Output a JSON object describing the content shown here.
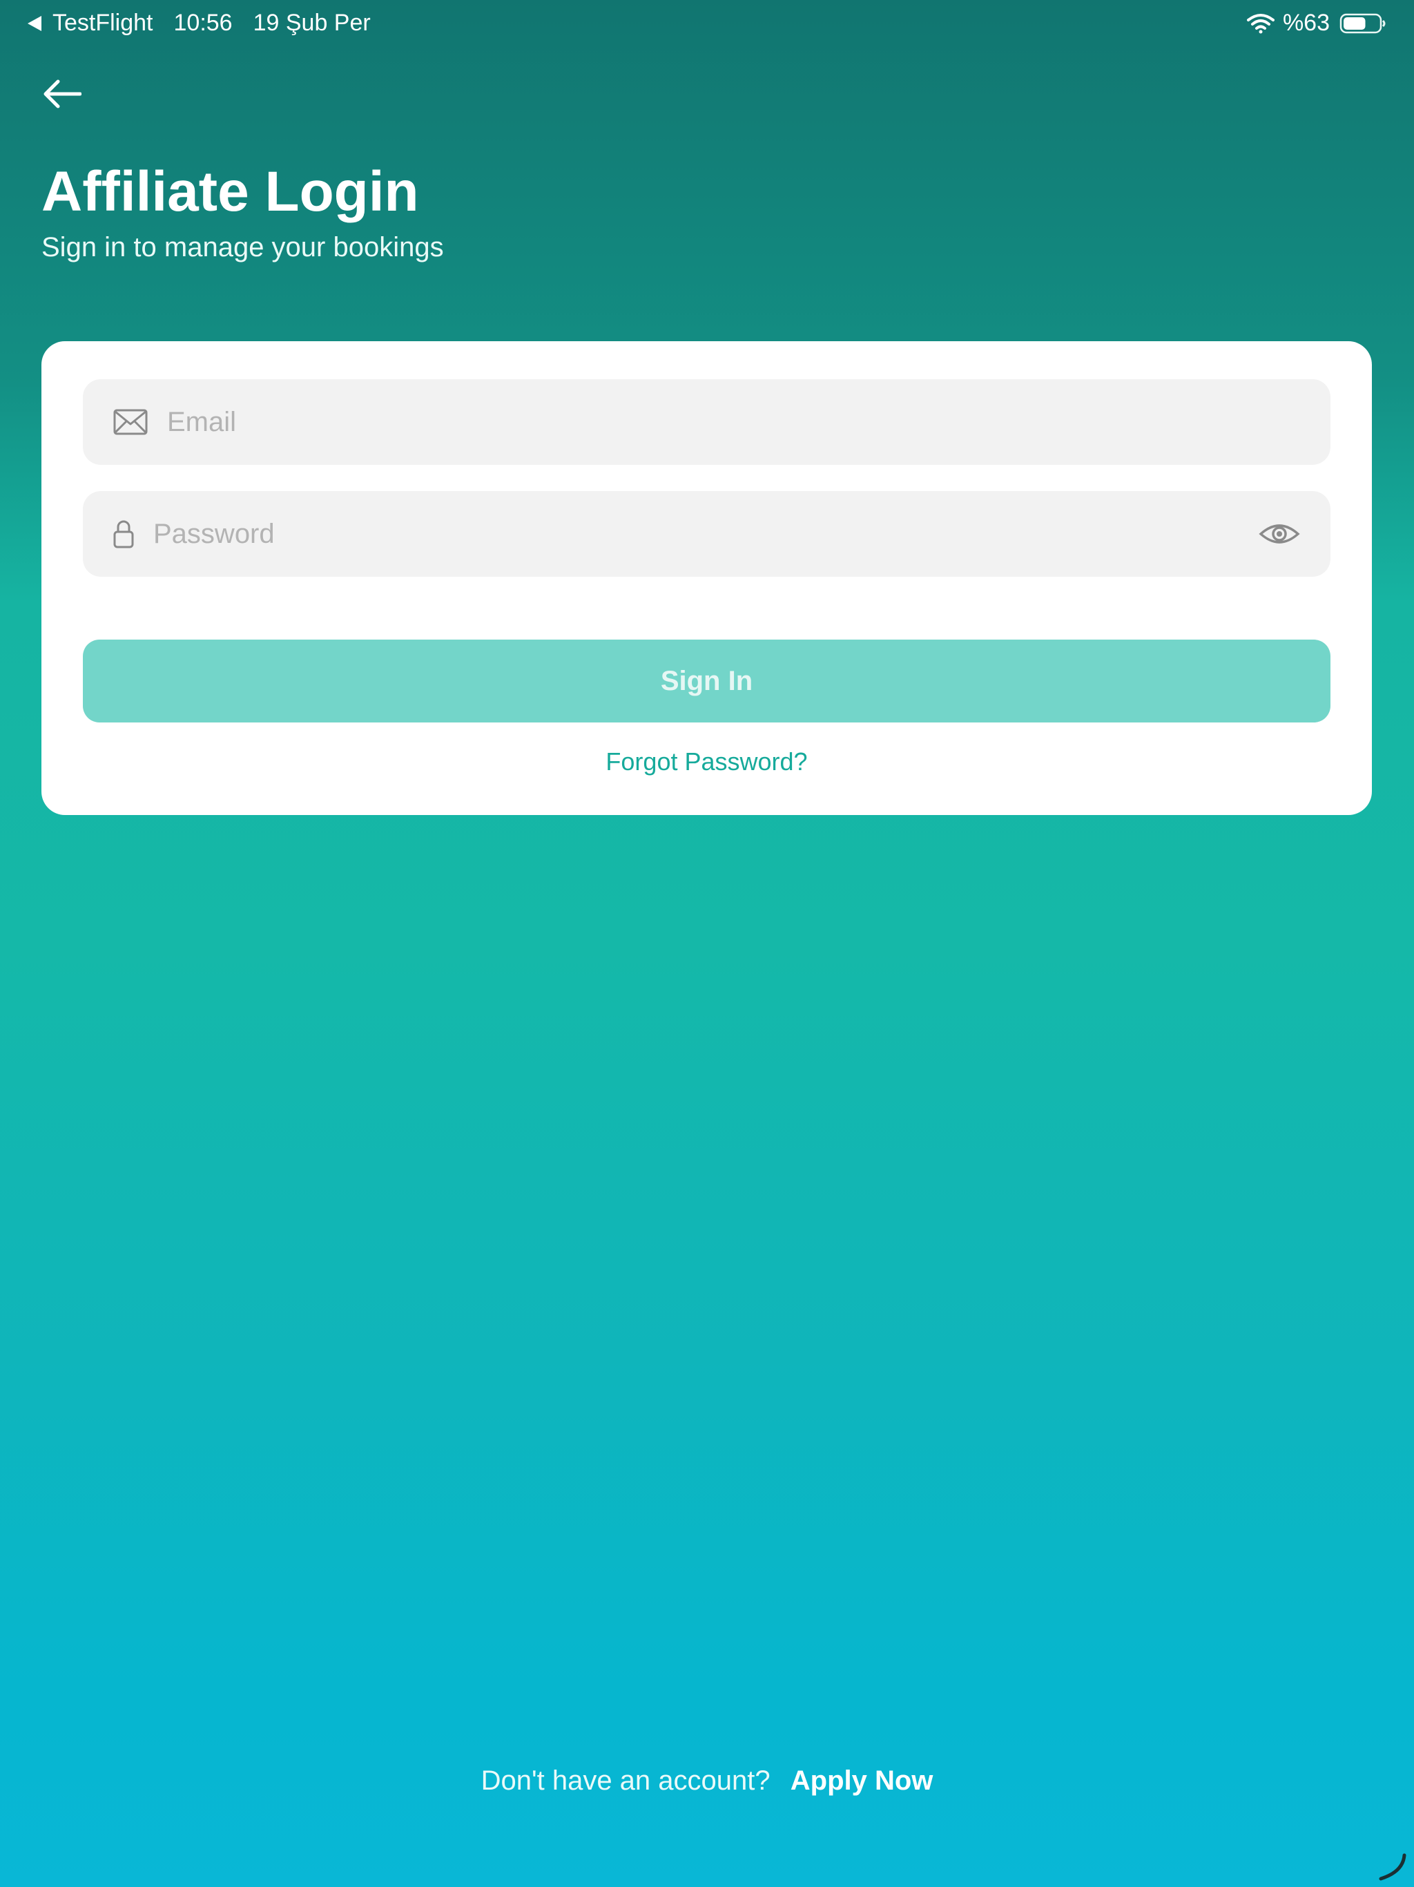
{
  "status_bar": {
    "app": "TestFlight",
    "time": "10:56",
    "date": "19 Şub Per",
    "battery": "%63",
    "battery_level": 0.63
  },
  "header": {
    "title": "Affiliate Login",
    "subtitle": "Sign in to manage your bookings"
  },
  "form": {
    "email_placeholder": "Email",
    "email_value": "",
    "password_placeholder": "Password",
    "password_value": "",
    "signin_label": "Sign In",
    "forgot_label": "Forgot Password?"
  },
  "footer": {
    "prompt": "Don't have an account?",
    "apply_label": "Apply Now"
  },
  "colors": {
    "accent": "#16aa9b",
    "button_disabled": "#73d5c9",
    "gradient_top": "#117570",
    "gradient_bottom": "#09b7d6"
  },
  "icons": {
    "back": "arrow-left-icon",
    "email": "envelope-icon",
    "password": "lock-icon",
    "toggle": "eye-icon"
  }
}
